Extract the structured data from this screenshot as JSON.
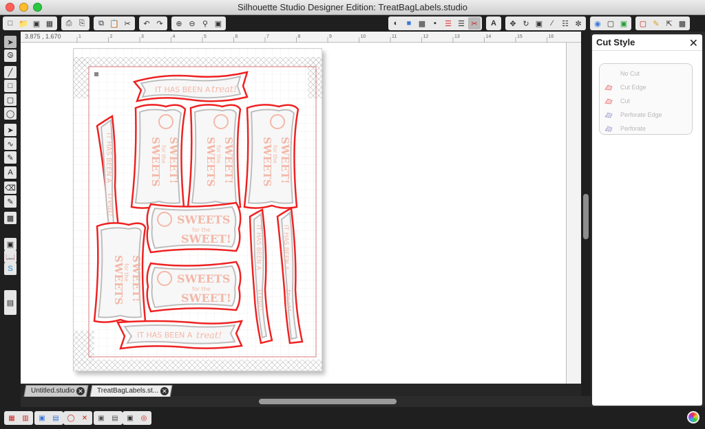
{
  "window": {
    "title": "Silhouette Studio Designer Edition: TreatBagLabels.studio"
  },
  "ruler": {
    "coords": "3.875 , 1.670",
    "top_ticks": [
      "1",
      "2",
      "3",
      "4",
      "5",
      "6",
      "7",
      "8",
      "9",
      "10",
      "11",
      "12",
      "13",
      "14",
      "15",
      "16"
    ]
  },
  "tabs": [
    {
      "label": "Untitled.studio"
    },
    {
      "label": "TreatBagLabels.st..."
    }
  ],
  "panel": {
    "title": "Cut Style",
    "options": [
      "No Cut",
      "Cut Edge",
      "Cut",
      "Perforate Edge",
      "Perforate"
    ]
  },
  "labels": {
    "banner": [
      "IT HAS BEEN A",
      "treat!"
    ],
    "bag": [
      "SWEETS",
      "for the",
      "SWEET!"
    ]
  },
  "colors": {
    "cut_line": "#ee2222",
    "label_fill": "#f3b8a8",
    "panel_text": "#b8b8b8"
  }
}
